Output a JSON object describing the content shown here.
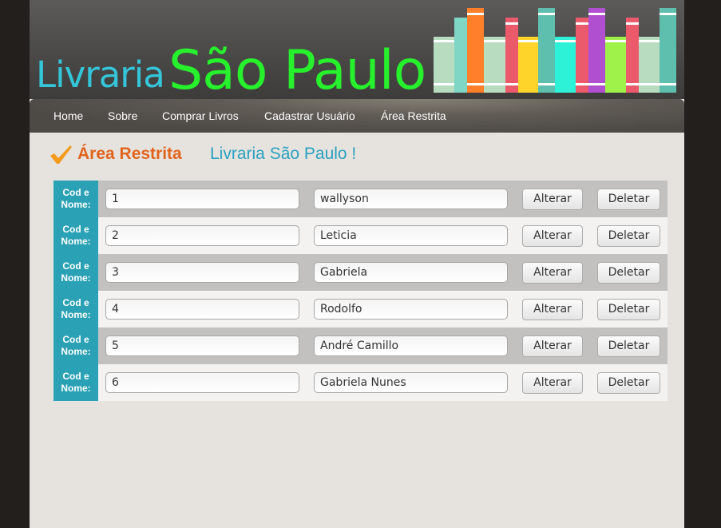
{
  "header": {
    "logo_small": "Livraria",
    "logo_big": "São Paulo",
    "colors": {
      "logo_small": "#35c5d9",
      "logo_big": "#27f02c"
    }
  },
  "nav": {
    "items": [
      {
        "label": "Home"
      },
      {
        "label": "Sobre"
      },
      {
        "label": "Comprar Livros"
      },
      {
        "label": "Cadastrar Usuário"
      },
      {
        "label": "Área Restrita"
      }
    ]
  },
  "page": {
    "title_part1": "Área Restrita",
    "title_part2": "Livraria São Paulo !",
    "colors": {
      "title_part1": "#e2641c",
      "title_part2": "#2aa1c0",
      "label_bg": "#2aa1b5"
    }
  },
  "table": {
    "row_label_line1": "Cod e",
    "row_label_line2": "Nome:",
    "alter_label": "Alterar",
    "delete_label": "Deletar",
    "rows": [
      {
        "cod": "1",
        "nome": "wallyson"
      },
      {
        "cod": "2",
        "nome": "Leticia"
      },
      {
        "cod": "3",
        "nome": "Gabriela"
      },
      {
        "cod": "4",
        "nome": "Rodolfo"
      },
      {
        "cod": "5",
        "nome": "André Camillo"
      },
      {
        "cod": "6",
        "nome": "Gabriela Nunes"
      }
    ]
  }
}
